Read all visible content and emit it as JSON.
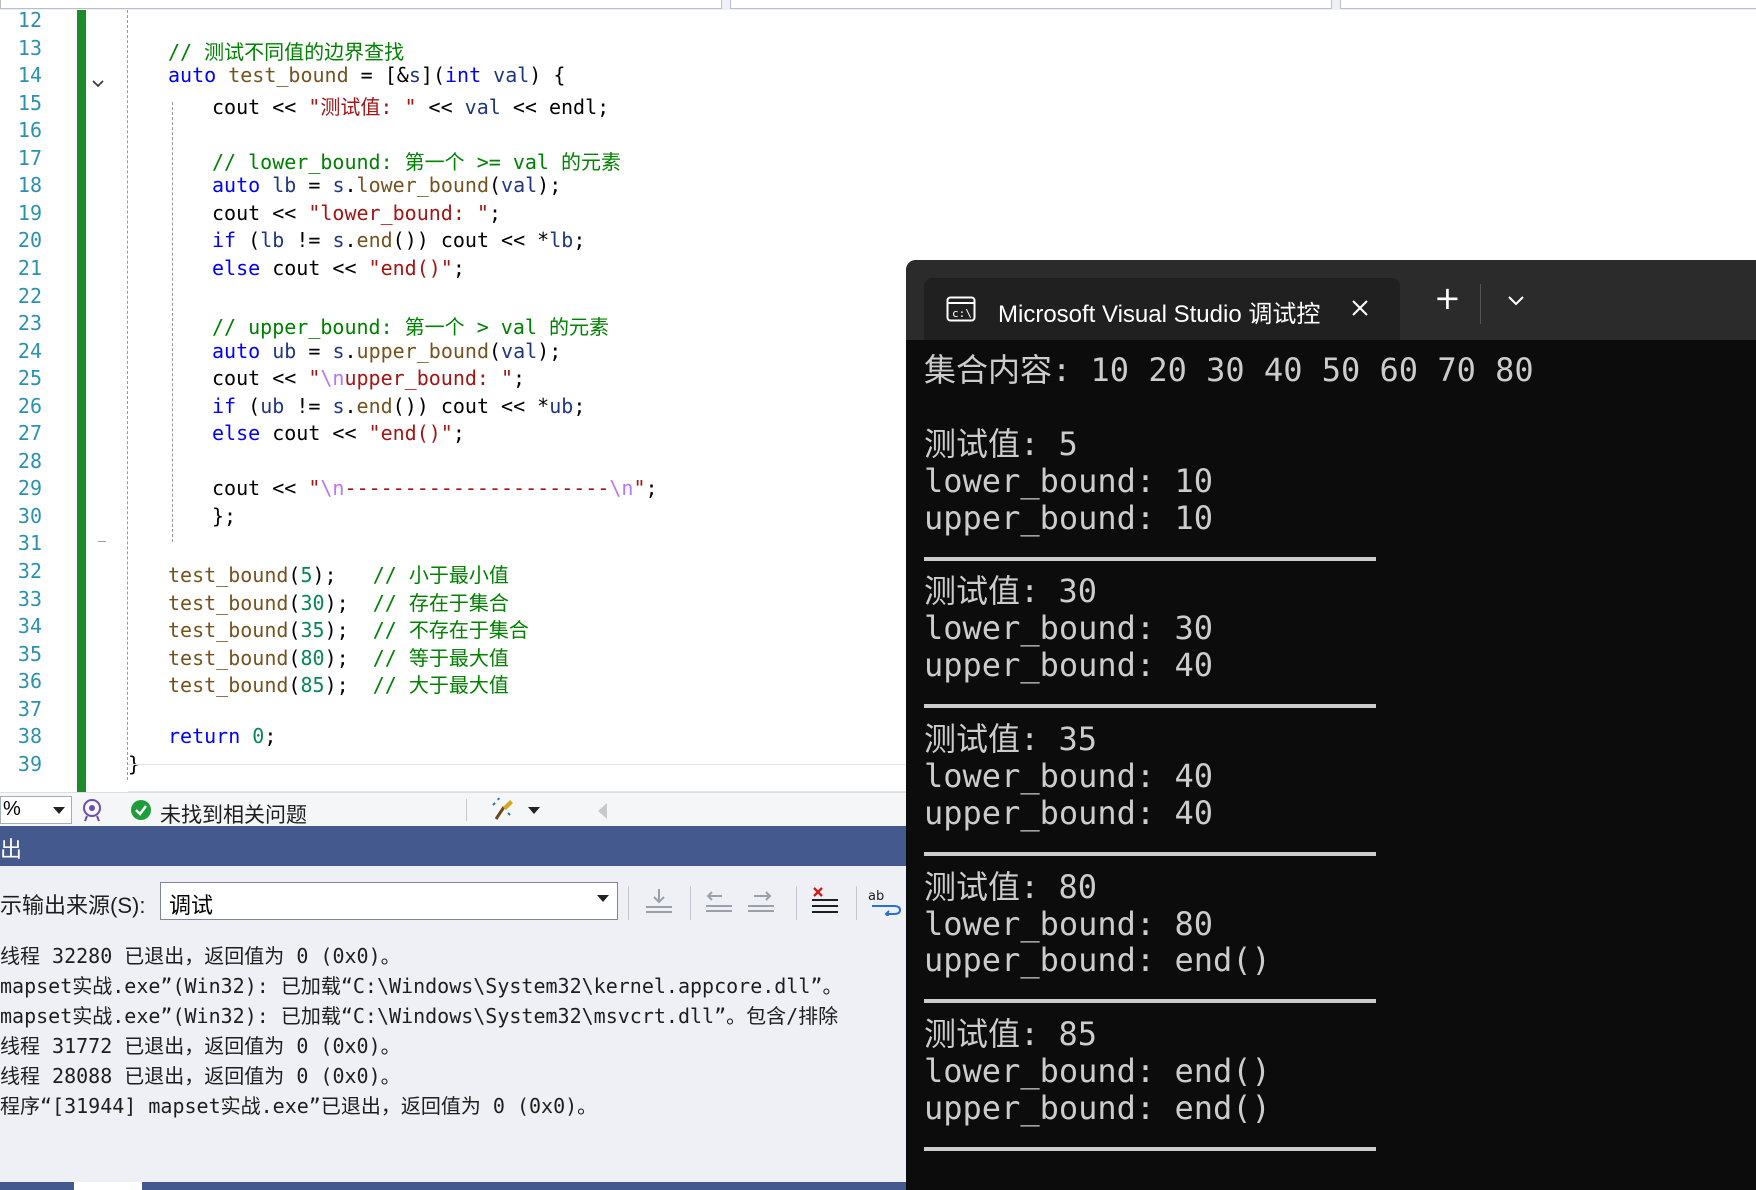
{
  "editor": {
    "line_numbers": [
      "12",
      "13",
      "14",
      "15",
      "16",
      "17",
      "18",
      "19",
      "20",
      "21",
      "22",
      "23",
      "24",
      "25",
      "26",
      "27",
      "28",
      "29",
      "30",
      "31",
      "32",
      "33",
      "34",
      "35",
      "36",
      "37",
      "38",
      "39"
    ],
    "code_lines": [
      "",
      "// 测试不同值的边界查找",
      "auto test_bound = [&s](int val) {",
      "cout << \"测试值: \" << val << endl;",
      "",
      "// lower_bound: 第一个 >= val 的元素",
      "auto lb = s.lower_bound(val);",
      "cout << \"lower_bound: \";",
      "if (lb != s.end()) cout << *lb;",
      "else cout << \"end()\";",
      "",
      "// upper_bound: 第一个 > val 的元素",
      "auto ub = s.upper_bound(val);",
      "cout << \"\\nupper_bound: \";",
      "if (ub != s.end()) cout << *ub;",
      "else cout << \"end()\";",
      "",
      "cout << \"\\n----------------------\\n\";",
      "};",
      "",
      "test_bound(5);   // 小于最小值",
      "test_bound(30);  // 存在于集合",
      "test_bound(35);  // 不存在于集合",
      "test_bound(80);  // 等于最大值",
      "test_bound(85);  // 大于最大值",
      "",
      "return 0;",
      "}"
    ]
  },
  "status_bar": {
    "zoom_value": "%",
    "issues_text": "未找到相关问题",
    "ok_color": "#1e9e3a"
  },
  "output_panel": {
    "title": "出",
    "source_label": "示输出来源(S):",
    "source_value": "调试",
    "log_lines": [
      "线程 32280 已退出，返回值为 0 (0x0)。",
      "mapset实战.exe”(Win32): 已加载“C:\\Windows\\System32\\kernel.appcore.dll”。",
      "mapset实战.exe”(Win32): 已加载“C:\\Windows\\System32\\msvcrt.dll”。包含/排除",
      "线程 31772 已退出，返回值为 0 (0x0)。",
      "线程 28088 已退出，返回值为 0 (0x0)。",
      "程序“[31944] mapset实战.exe”已退出，返回值为 0 (0x0)。"
    ]
  },
  "console": {
    "tab_title": "Microsoft Visual Studio 调试控",
    "new_tab_symbol": "+",
    "output_lines": [
      {
        "kind": "text",
        "text": "集合内容: 10 20 30 40 50 60 70 80"
      },
      {
        "kind": "blank",
        "text": ""
      },
      {
        "kind": "text",
        "text": "测试值: 5"
      },
      {
        "kind": "text",
        "text": "lower_bound: 10"
      },
      {
        "kind": "text",
        "text": "upper_bound: 10"
      },
      {
        "kind": "rule",
        "text": "----------------------"
      },
      {
        "kind": "text",
        "text": "测试值: 30"
      },
      {
        "kind": "text",
        "text": "lower_bound: 30"
      },
      {
        "kind": "text",
        "text": "upper_bound: 40"
      },
      {
        "kind": "rule",
        "text": "----------------------"
      },
      {
        "kind": "text",
        "text": "测试值: 35"
      },
      {
        "kind": "text",
        "text": "lower_bound: 40"
      },
      {
        "kind": "text",
        "text": "upper_bound: 40"
      },
      {
        "kind": "rule",
        "text": "----------------------"
      },
      {
        "kind": "text",
        "text": "测试值: 80"
      },
      {
        "kind": "text",
        "text": "lower_bound: 80"
      },
      {
        "kind": "text",
        "text": "upper_bound: end()"
      },
      {
        "kind": "rule",
        "text": "----------------------"
      },
      {
        "kind": "text",
        "text": "测试值: 85"
      },
      {
        "kind": "text",
        "text": "lower_bound: end()"
      },
      {
        "kind": "text",
        "text": "upper_bound: end()"
      },
      {
        "kind": "rule",
        "text": "----------------------"
      }
    ]
  },
  "colors": {
    "change_bar": "#1e8a29",
    "output_header": "#44598d",
    "console_bg": "#0c0c0c",
    "console_fg": "#cccccc"
  }
}
